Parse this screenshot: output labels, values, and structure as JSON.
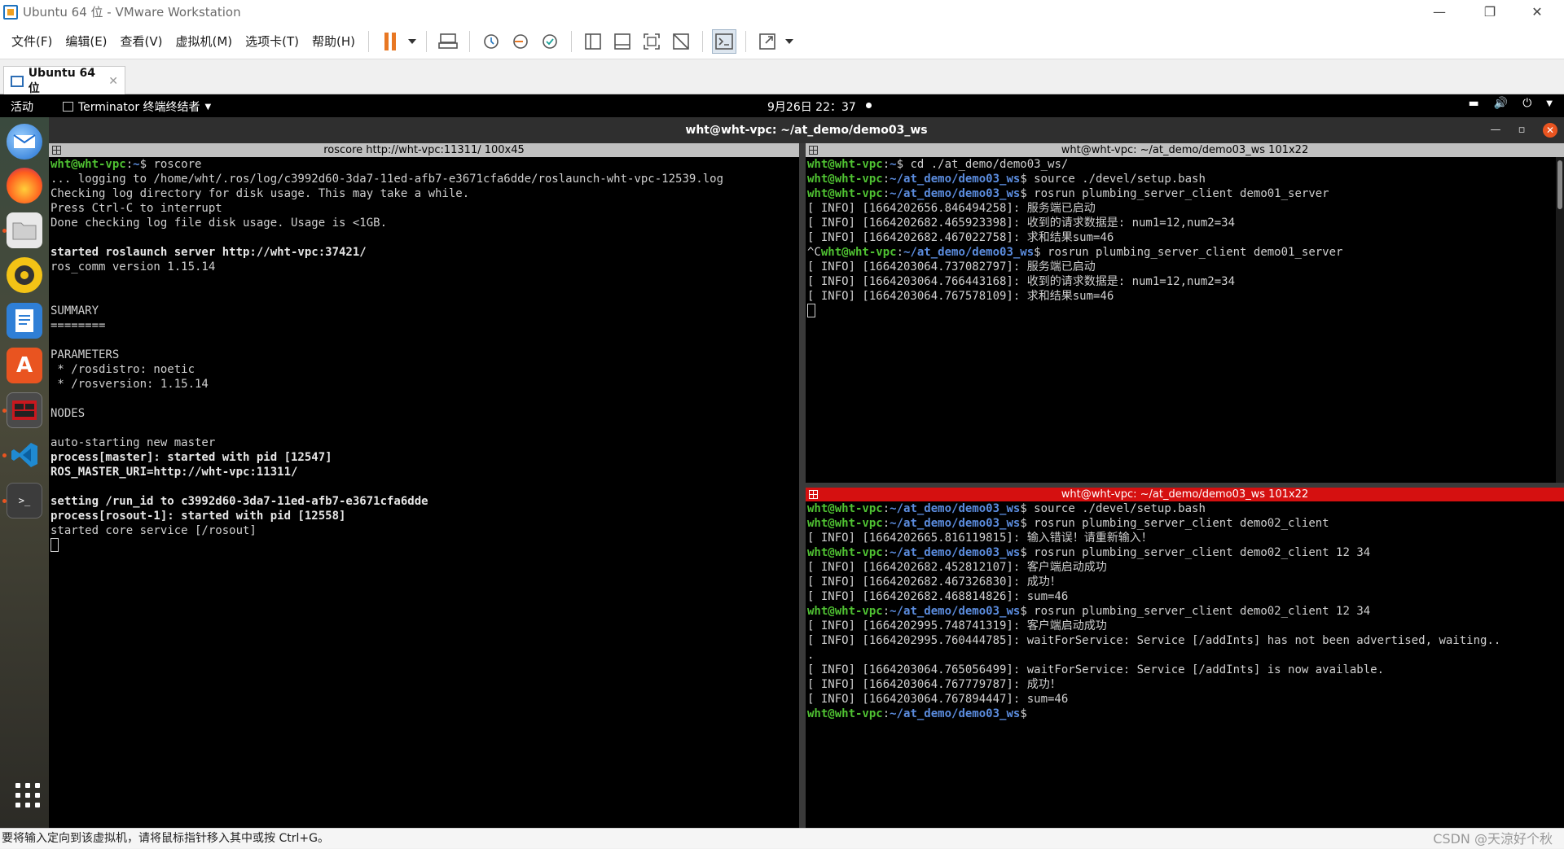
{
  "vmware": {
    "title": "Ubuntu 64 位 - VMware Workstation",
    "window_controls": {
      "minimize": "—",
      "restore": "❐",
      "close": "✕"
    },
    "menus": [
      "文件(F)",
      "编辑(E)",
      "查看(V)",
      "虚拟机(M)",
      "选项卡(T)",
      "帮助(H)"
    ],
    "toolbar_icons": [
      "pause-icon",
      "send-keys-icon",
      "snapshot-icon",
      "revert-snapshot-icon",
      "snapshot-manager-icon",
      "library-view-icon",
      "thumbnail-view-icon",
      "fullscreen-icon",
      "unity-icon",
      "console-view-icon",
      "stretch-icon"
    ],
    "accent_color": "#e87722",
    "tab_label": "Ubuntu 64 位",
    "tab_close": "✕",
    "status_text": "要将输入定向到该虚拟机，请将鼠标指针移入其中或按 Ctrl+G。",
    "watermark": "CSDN @天涼好个秋"
  },
  "gnome": {
    "activities": "活动",
    "app_menu": "Terminator 终端终结者",
    "clock": "9月26日  22：37"
  },
  "dock": {
    "items": [
      "thunderbird-icon",
      "firefox-icon",
      "files-icon",
      "rhythmbox-icon",
      "libreoffice-writer-icon",
      "software-center-icon",
      "terminator-icon",
      "vscode-icon",
      "terminal-icon"
    ],
    "show_apps": "show-apps-icon"
  },
  "terminator": {
    "window_title": "wht@wht-vpc: ~/at_demo/demo03_ws",
    "panes": {
      "left": {
        "title": "roscore http://wht-vpc:11311/ 100x45",
        "lines": [
          {
            "kind": "prompt",
            "user": "wht@wht-vpc",
            "path": "~",
            "cmd": "$ roscore"
          },
          {
            "kind": "text",
            "text": "... logging to /home/wht/.ros/log/c3992d60-3da7-11ed-afb7-e3671cfa6dde/roslaunch-wht-vpc-12539.log"
          },
          {
            "kind": "text",
            "text": "Checking log directory for disk usage. This may take a while."
          },
          {
            "kind": "text",
            "text": "Press Ctrl-C to interrupt"
          },
          {
            "kind": "text",
            "text": "Done checking log file disk usage. Usage is <1GB."
          },
          {
            "kind": "text",
            "text": ""
          },
          {
            "kind": "bold",
            "text": "started roslaunch server http://wht-vpc:37421/"
          },
          {
            "kind": "text",
            "text": "ros_comm version 1.15.14"
          },
          {
            "kind": "text",
            "text": ""
          },
          {
            "kind": "text",
            "text": ""
          },
          {
            "kind": "text",
            "text": "SUMMARY"
          },
          {
            "kind": "text",
            "text": "========"
          },
          {
            "kind": "text",
            "text": ""
          },
          {
            "kind": "text",
            "text": "PARAMETERS"
          },
          {
            "kind": "text",
            "text": " * /rosdistro: noetic"
          },
          {
            "kind": "text",
            "text": " * /rosversion: 1.15.14"
          },
          {
            "kind": "text",
            "text": ""
          },
          {
            "kind": "text",
            "text": "NODES"
          },
          {
            "kind": "text",
            "text": ""
          },
          {
            "kind": "text",
            "text": "auto-starting new master"
          },
          {
            "kind": "bold",
            "text": "process[master]: started with pid [12547]"
          },
          {
            "kind": "bold",
            "text": "ROS_MASTER_URI=http://wht-vpc:11311/"
          },
          {
            "kind": "text",
            "text": ""
          },
          {
            "kind": "bold",
            "text": "setting /run_id to c3992d60-3da7-11ed-afb7-e3671cfa6dde"
          },
          {
            "kind": "bold",
            "text": "process[rosout-1]: started with pid [12558]"
          },
          {
            "kind": "text",
            "text": "started core service [/rosout]"
          },
          {
            "kind": "cursor",
            "text": ""
          }
        ]
      },
      "top_right": {
        "title": "wht@wht-vpc: ~/at_demo/demo03_ws 101x22",
        "lines": [
          {
            "kind": "prompt",
            "user": "wht@wht-vpc",
            "path": "~",
            "cmd": "$ cd ./at_demo/demo03_ws/"
          },
          {
            "kind": "prompt",
            "user": "wht@wht-vpc",
            "path": "~/at_demo/demo03_ws",
            "cmd": "$ source ./devel/setup.bash"
          },
          {
            "kind": "prompt",
            "user": "wht@wht-vpc",
            "path": "~/at_demo/demo03_ws",
            "cmd": "$ rosrun plumbing_server_client demo01_server"
          },
          {
            "kind": "text",
            "text": "[ INFO] [1664202656.846494258]: 服务端已启动"
          },
          {
            "kind": "text",
            "text": "[ INFO] [1664202682.465923398]: 收到的请求数据是: num1=12,num2=34"
          },
          {
            "kind": "text",
            "text": "[ INFO] [1664202682.467022758]: 求和结果sum=46"
          },
          {
            "kind": "prompt",
            "pre": "^C",
            "user": "wht@wht-vpc",
            "path": "~/at_demo/demo03_ws",
            "cmd": "$ rosrun plumbing_server_client demo01_server"
          },
          {
            "kind": "text",
            "text": "[ INFO] [1664203064.737082797]: 服务端已启动"
          },
          {
            "kind": "text",
            "text": "[ INFO] [1664203064.766443168]: 收到的请求数据是: num1=12,num2=34"
          },
          {
            "kind": "text",
            "text": "[ INFO] [1664203064.767578109]: 求和结果sum=46"
          },
          {
            "kind": "cursor",
            "text": ""
          }
        ]
      },
      "bottom_right": {
        "title": "wht@wht-vpc: ~/at_demo/demo03_ws 101x22",
        "lines": [
          {
            "kind": "prompt",
            "user": "wht@wht-vpc",
            "path": "~/at_demo/demo03_ws",
            "cmd": "$ source ./devel/setup.bash"
          },
          {
            "kind": "prompt",
            "user": "wht@wht-vpc",
            "path": "~/at_demo/demo03_ws",
            "cmd": "$ rosrun plumbing_server_client demo02_client"
          },
          {
            "kind": "text",
            "text": "[ INFO] [1664202665.816119815]: 输入错误！请重新输入！"
          },
          {
            "kind": "prompt",
            "user": "wht@wht-vpc",
            "path": "~/at_demo/demo03_ws",
            "cmd": "$ rosrun plumbing_server_client demo02_client 12 34"
          },
          {
            "kind": "text",
            "text": "[ INFO] [1664202682.452812107]: 客户端启动成功"
          },
          {
            "kind": "text",
            "text": "[ INFO] [1664202682.467326830]: 成功！"
          },
          {
            "kind": "text",
            "text": "[ INFO] [1664202682.468814826]: sum=46"
          },
          {
            "kind": "prompt",
            "user": "wht@wht-vpc",
            "path": "~/at_demo/demo03_ws",
            "cmd": "$ rosrun plumbing_server_client demo02_client 12 34"
          },
          {
            "kind": "text",
            "text": "[ INFO] [1664202995.748741319]: 客户端启动成功"
          },
          {
            "kind": "text",
            "text": "[ INFO] [1664202995.760444785]: waitForService: Service [/addInts] has not been advertised, waiting.."
          },
          {
            "kind": "text",
            "text": "."
          },
          {
            "kind": "text",
            "text": "[ INFO] [1664203064.765056499]: waitForService: Service [/addInts] is now available."
          },
          {
            "kind": "text",
            "text": "[ INFO] [1664203064.767779787]: 成功！"
          },
          {
            "kind": "text",
            "text": "[ INFO] [1664203064.767894447]: sum=46"
          },
          {
            "kind": "prompt",
            "user": "wht@wht-vpc",
            "path": "~/at_demo/demo03_ws",
            "cmd": "$"
          }
        ]
      }
    },
    "colors": {
      "user": "#4fc132",
      "path": "#5b8cde",
      "active_pane": "#d51010",
      "close": "#e95420"
    }
  }
}
